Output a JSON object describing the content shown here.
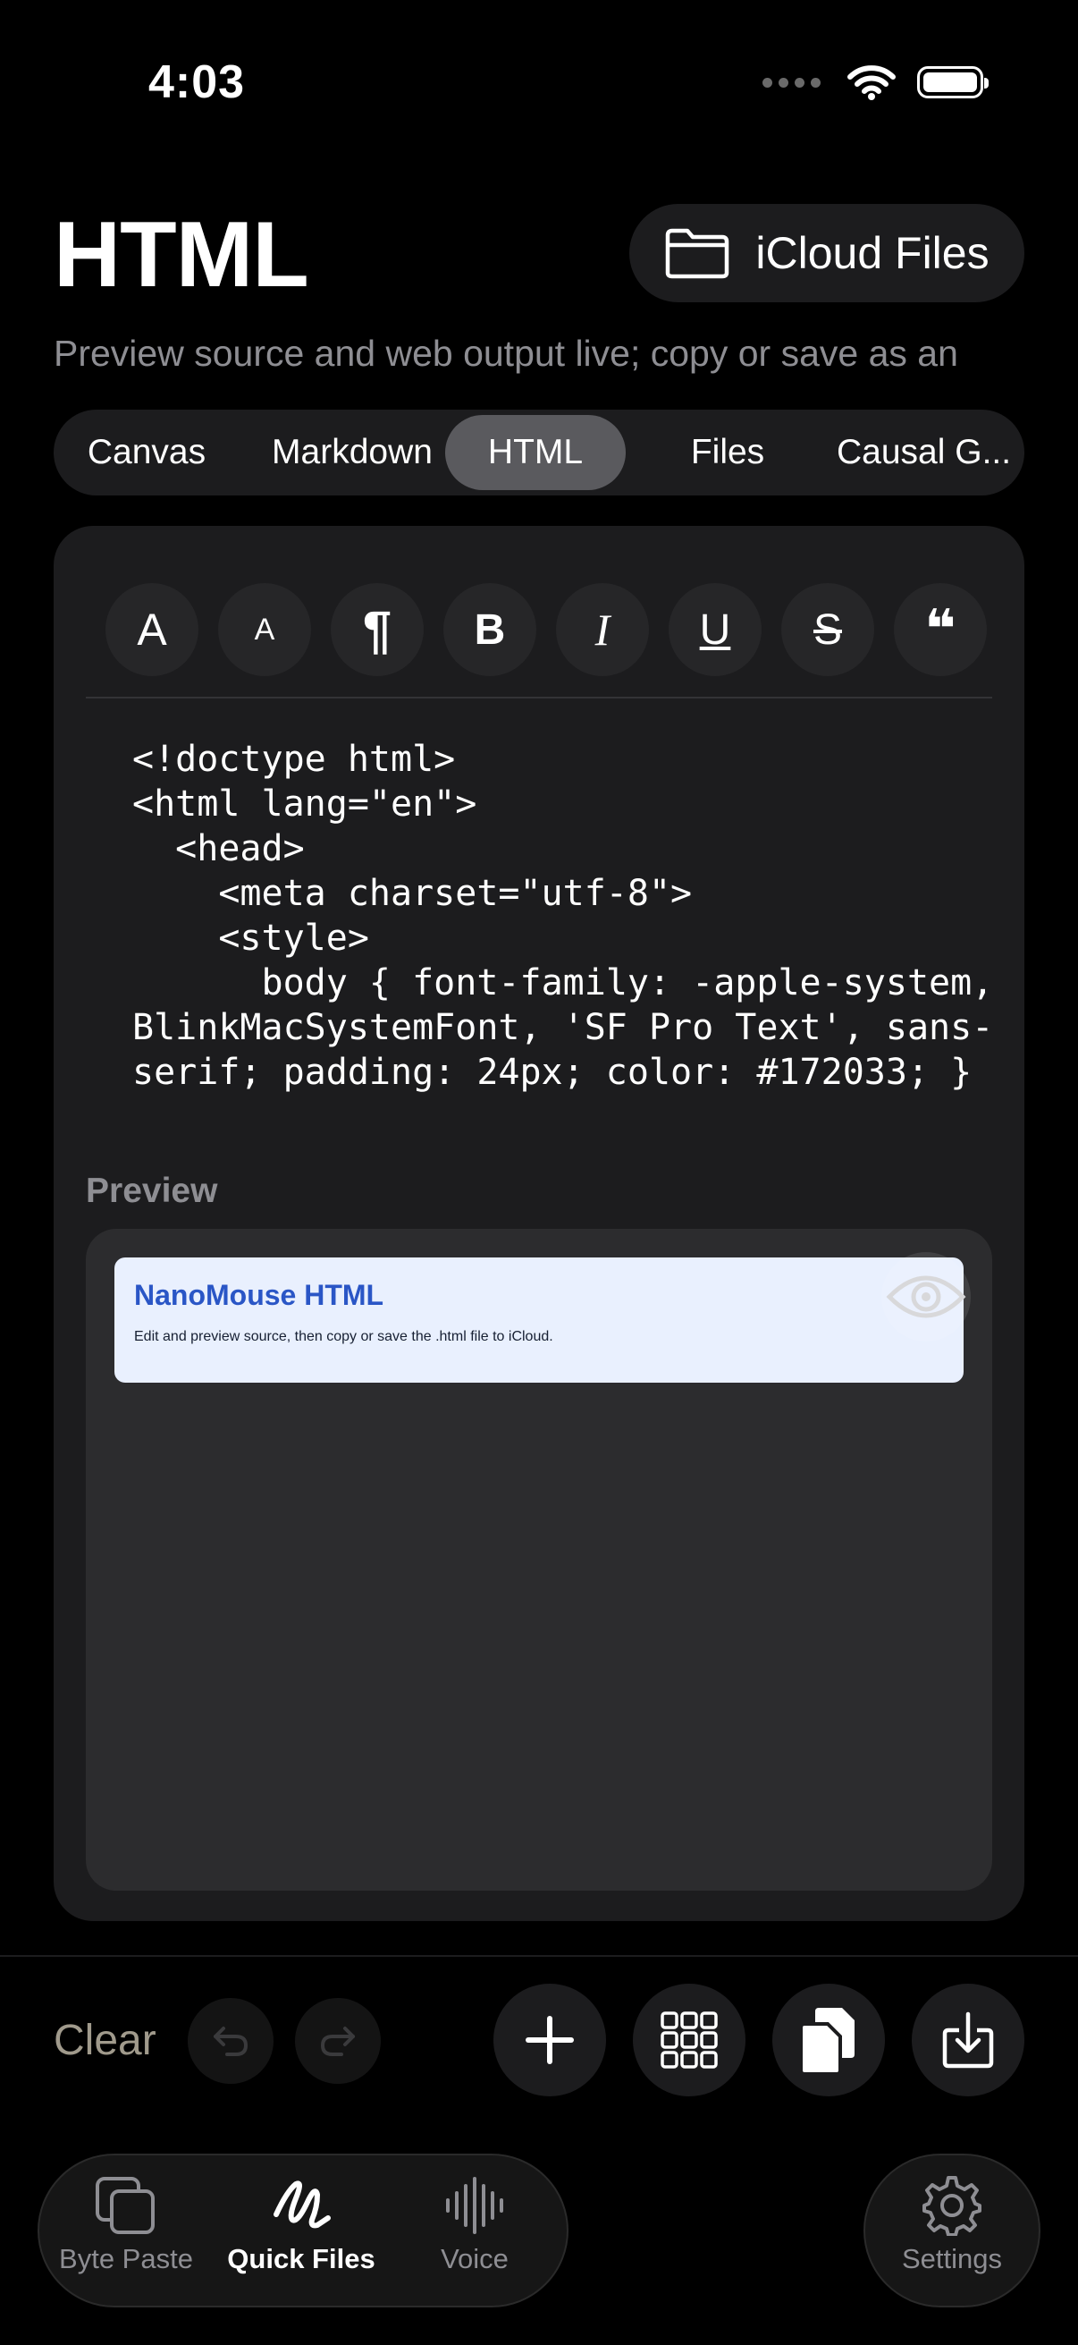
{
  "status_bar": {
    "time": "4:03"
  },
  "header": {
    "title": "HTML",
    "icloud_button_label": "iCloud Files",
    "subtitle": "Preview source and web output live; copy or save as an"
  },
  "mode_tabs": [
    {
      "label": "Canvas",
      "active": false
    },
    {
      "label": "Markdown",
      "active": false
    },
    {
      "label": "HTML",
      "active": true
    },
    {
      "label": "Files",
      "active": false
    },
    {
      "label": "Causal G...",
      "active": false
    }
  ],
  "format_buttons": [
    {
      "name": "font-larger-icon",
      "glyph": "A"
    },
    {
      "name": "font-smaller-icon",
      "glyph": "A"
    },
    {
      "name": "paragraph-icon",
      "glyph": "¶"
    },
    {
      "name": "bold-icon",
      "glyph": "B"
    },
    {
      "name": "italic-icon",
      "glyph": "I"
    },
    {
      "name": "underline-icon",
      "glyph": "U"
    },
    {
      "name": "strikethrough-icon",
      "glyph": "S"
    },
    {
      "name": "quote-icon",
      "glyph": "❝"
    }
  ],
  "editor": {
    "code": "<!doctype html>\n<html lang=\"en\">\n  <head>\n    <meta charset=\"utf-8\">\n    <style>\n      body { font-family: -apple-system, BlinkMacSystemFont, 'SF Pro Text', sans-serif; padding: 24px; color: #172033; }"
  },
  "preview": {
    "label": "Preview",
    "doc_title": "NanoMouse HTML",
    "doc_text": "Edit and preview source, then copy or save the .html file to iCloud."
  },
  "toolbar": {
    "clear_label": "Clear",
    "undo_icon": "undo-icon",
    "redo_icon": "redo-icon",
    "add_icon": "plus-icon",
    "grid_icon": "grid-icon",
    "copy_icon": "copy-icon",
    "save_icon": "download-icon"
  },
  "tab_bar": {
    "items": [
      {
        "label": "Byte Paste",
        "icon": "byte-paste-icon",
        "active": false
      },
      {
        "label": "Quick Files",
        "icon": "quick-files-icon",
        "active": true
      },
      {
        "label": "Voice",
        "icon": "waveform-icon",
        "active": false
      }
    ],
    "settings_label": "Settings"
  },
  "colors": {
    "background": "#000000",
    "surface": "#1c1c1e",
    "active_tab": "#5a5a5e",
    "preview_accent": "#2a56c6",
    "preview_bg": "#e9f0fe"
  }
}
